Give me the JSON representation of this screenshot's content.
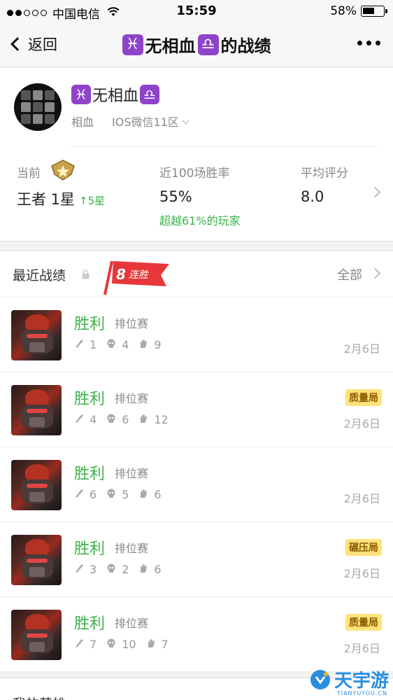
{
  "status_bar": {
    "carrier": "中国电信",
    "time": "15:59",
    "battery": "58%",
    "battery_level": 0.58
  },
  "nav": {
    "back_label": "返回",
    "title_prefix_zodiac": "♓",
    "title_name": "无相血",
    "title_suffix_zodiac": "♎",
    "title_tail": "的战绩"
  },
  "profile": {
    "name_prefix_zodiac": "♓",
    "name": "无相血",
    "name_suffix_zodiac": "♎",
    "nickname": "相血",
    "server": "IOS微信11区",
    "current_label": "当前",
    "rank": "王者 1星",
    "rank_change": "↑5星",
    "winrate_label": "近100场胜率",
    "winrate": "55%",
    "winrate_note": "超越61%的玩家",
    "avg_label": "平均评分",
    "avg_score": "8.0"
  },
  "recent": {
    "title": "最近战绩",
    "streak_count": "8",
    "streak_label": "连胜",
    "all_label": "全部",
    "matches": [
      {
        "result": "胜利",
        "mode": "排位赛",
        "kills": "1",
        "deaths": "4",
        "assists": "9",
        "date": "2月6日",
        "badge": ""
      },
      {
        "result": "胜利",
        "mode": "排位赛",
        "kills": "4",
        "deaths": "6",
        "assists": "12",
        "date": "2月6日",
        "badge": "质量局"
      },
      {
        "result": "胜利",
        "mode": "排位赛",
        "kills": "6",
        "deaths": "5",
        "assists": "6",
        "date": "2月6日",
        "badge": ""
      },
      {
        "result": "胜利",
        "mode": "排位赛",
        "kills": "3",
        "deaths": "2",
        "assists": "6",
        "date": "2月6日",
        "badge": "碾压局"
      },
      {
        "result": "胜利",
        "mode": "排位赛",
        "kills": "7",
        "deaths": "10",
        "assists": "7",
        "date": "2月6日",
        "badge": "质量局"
      }
    ]
  },
  "bottom_section": {
    "title": "我的英雄"
  },
  "watermark": {
    "text": "天宇游",
    "url": "TIANYUYOU.CN"
  },
  "colors": {
    "accent_green": "#3bb34a",
    "badge_bg": "#ffe27a",
    "zodiac_purple": "#8e44c9",
    "streak_red": "#e8373a"
  }
}
